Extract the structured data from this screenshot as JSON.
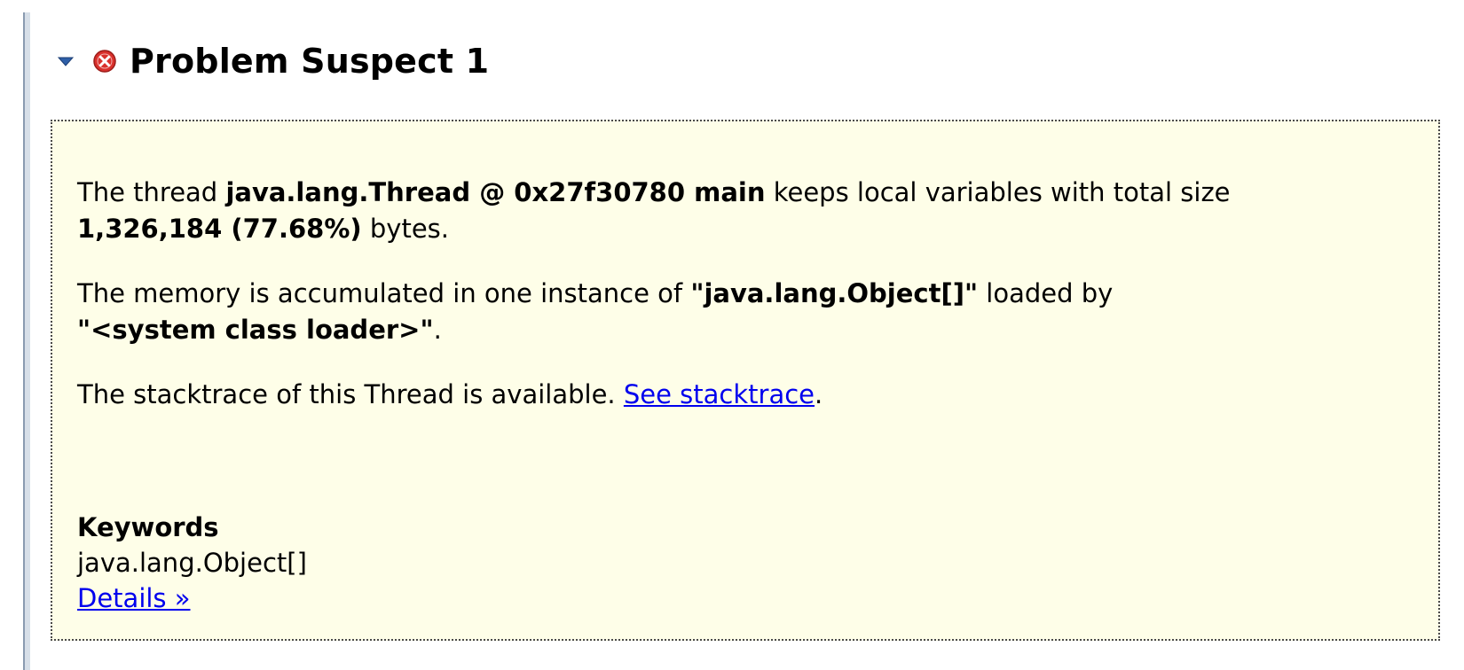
{
  "header": {
    "title": "Problem Suspect 1",
    "toggle_icon": "chevron-down-icon",
    "status_icon": "error-icon",
    "colors": {
      "toggle": "#2e5fa8",
      "error": "#d9302c"
    }
  },
  "panel": {
    "background": "#fefee8",
    "para1": {
      "t1": "The thread ",
      "b1": "java.lang.Thread @ 0x27f30780 main",
      "t2": " keeps local variables with total size ",
      "b2": "1,326,184 (77.68%)",
      "t3": " bytes."
    },
    "para2": {
      "t1": "The memory is accumulated in one instance of ",
      "b1": "\"java.lang.Object[]\"",
      "t2": " loaded by ",
      "b2": "\"<system class loader>\"",
      "t3": "."
    },
    "para3": {
      "t1": "The stacktrace of this Thread is available. ",
      "link": "See stacktrace",
      "t2": "."
    },
    "keywords": {
      "heading": "Keywords",
      "value": "java.lang.Object[]",
      "details_link": "Details »"
    },
    "link_color": "#0000ee"
  }
}
